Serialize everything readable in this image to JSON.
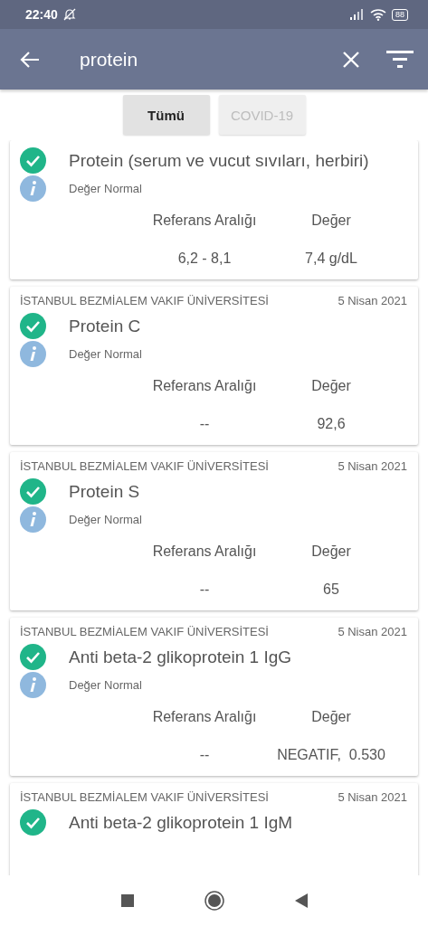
{
  "status_bar": {
    "time": "22:40",
    "battery": "88"
  },
  "search": {
    "value": "protein"
  },
  "tabs": [
    {
      "label": "Tümü",
      "selected": true
    },
    {
      "label": "COVID-19",
      "selected": false
    }
  ],
  "results": [
    {
      "title": "Protein (serum ve vucut sıvıları, herbiri)",
      "status": "Değer Normal",
      "range_label": "Referans Aralığı",
      "value_label": "Değer",
      "range": "6,2 - 8,1",
      "value": "7,4 g/dL"
    },
    {
      "institution": "İSTANBUL BEZMİALEM VAKIF ÜNİVERSİTESİ",
      "date": "5 Nisan 2021",
      "title": "Protein C",
      "status": "Değer Normal",
      "range_label": "Referans Aralığı",
      "value_label": "Değer",
      "range": "--",
      "value": "92,6"
    },
    {
      "institution": "İSTANBUL BEZMİALEM VAKIF ÜNİVERSİTESİ",
      "date": "5 Nisan 2021",
      "title": "Protein S",
      "status": "Değer Normal",
      "range_label": "Referans Aralığı",
      "value_label": "Değer",
      "range": "--",
      "value": "65"
    },
    {
      "institution": "İSTANBUL BEZMİALEM VAKIF ÜNİVERSİTESİ",
      "date": "5 Nisan 2021",
      "title": "Anti beta-2 glikoprotein 1 IgG",
      "status": "Değer Normal",
      "range_label": "Referans Aralığı",
      "value_label": "Değer",
      "range": "--",
      "value": "NEGATIF,  0.530"
    },
    {
      "institution": "İSTANBUL BEZMİALEM VAKIF ÜNİVERSİTESİ",
      "date": "5 Nisan 2021",
      "title": "Anti beta-2 glikoprotein 1 IgM"
    }
  ]
}
